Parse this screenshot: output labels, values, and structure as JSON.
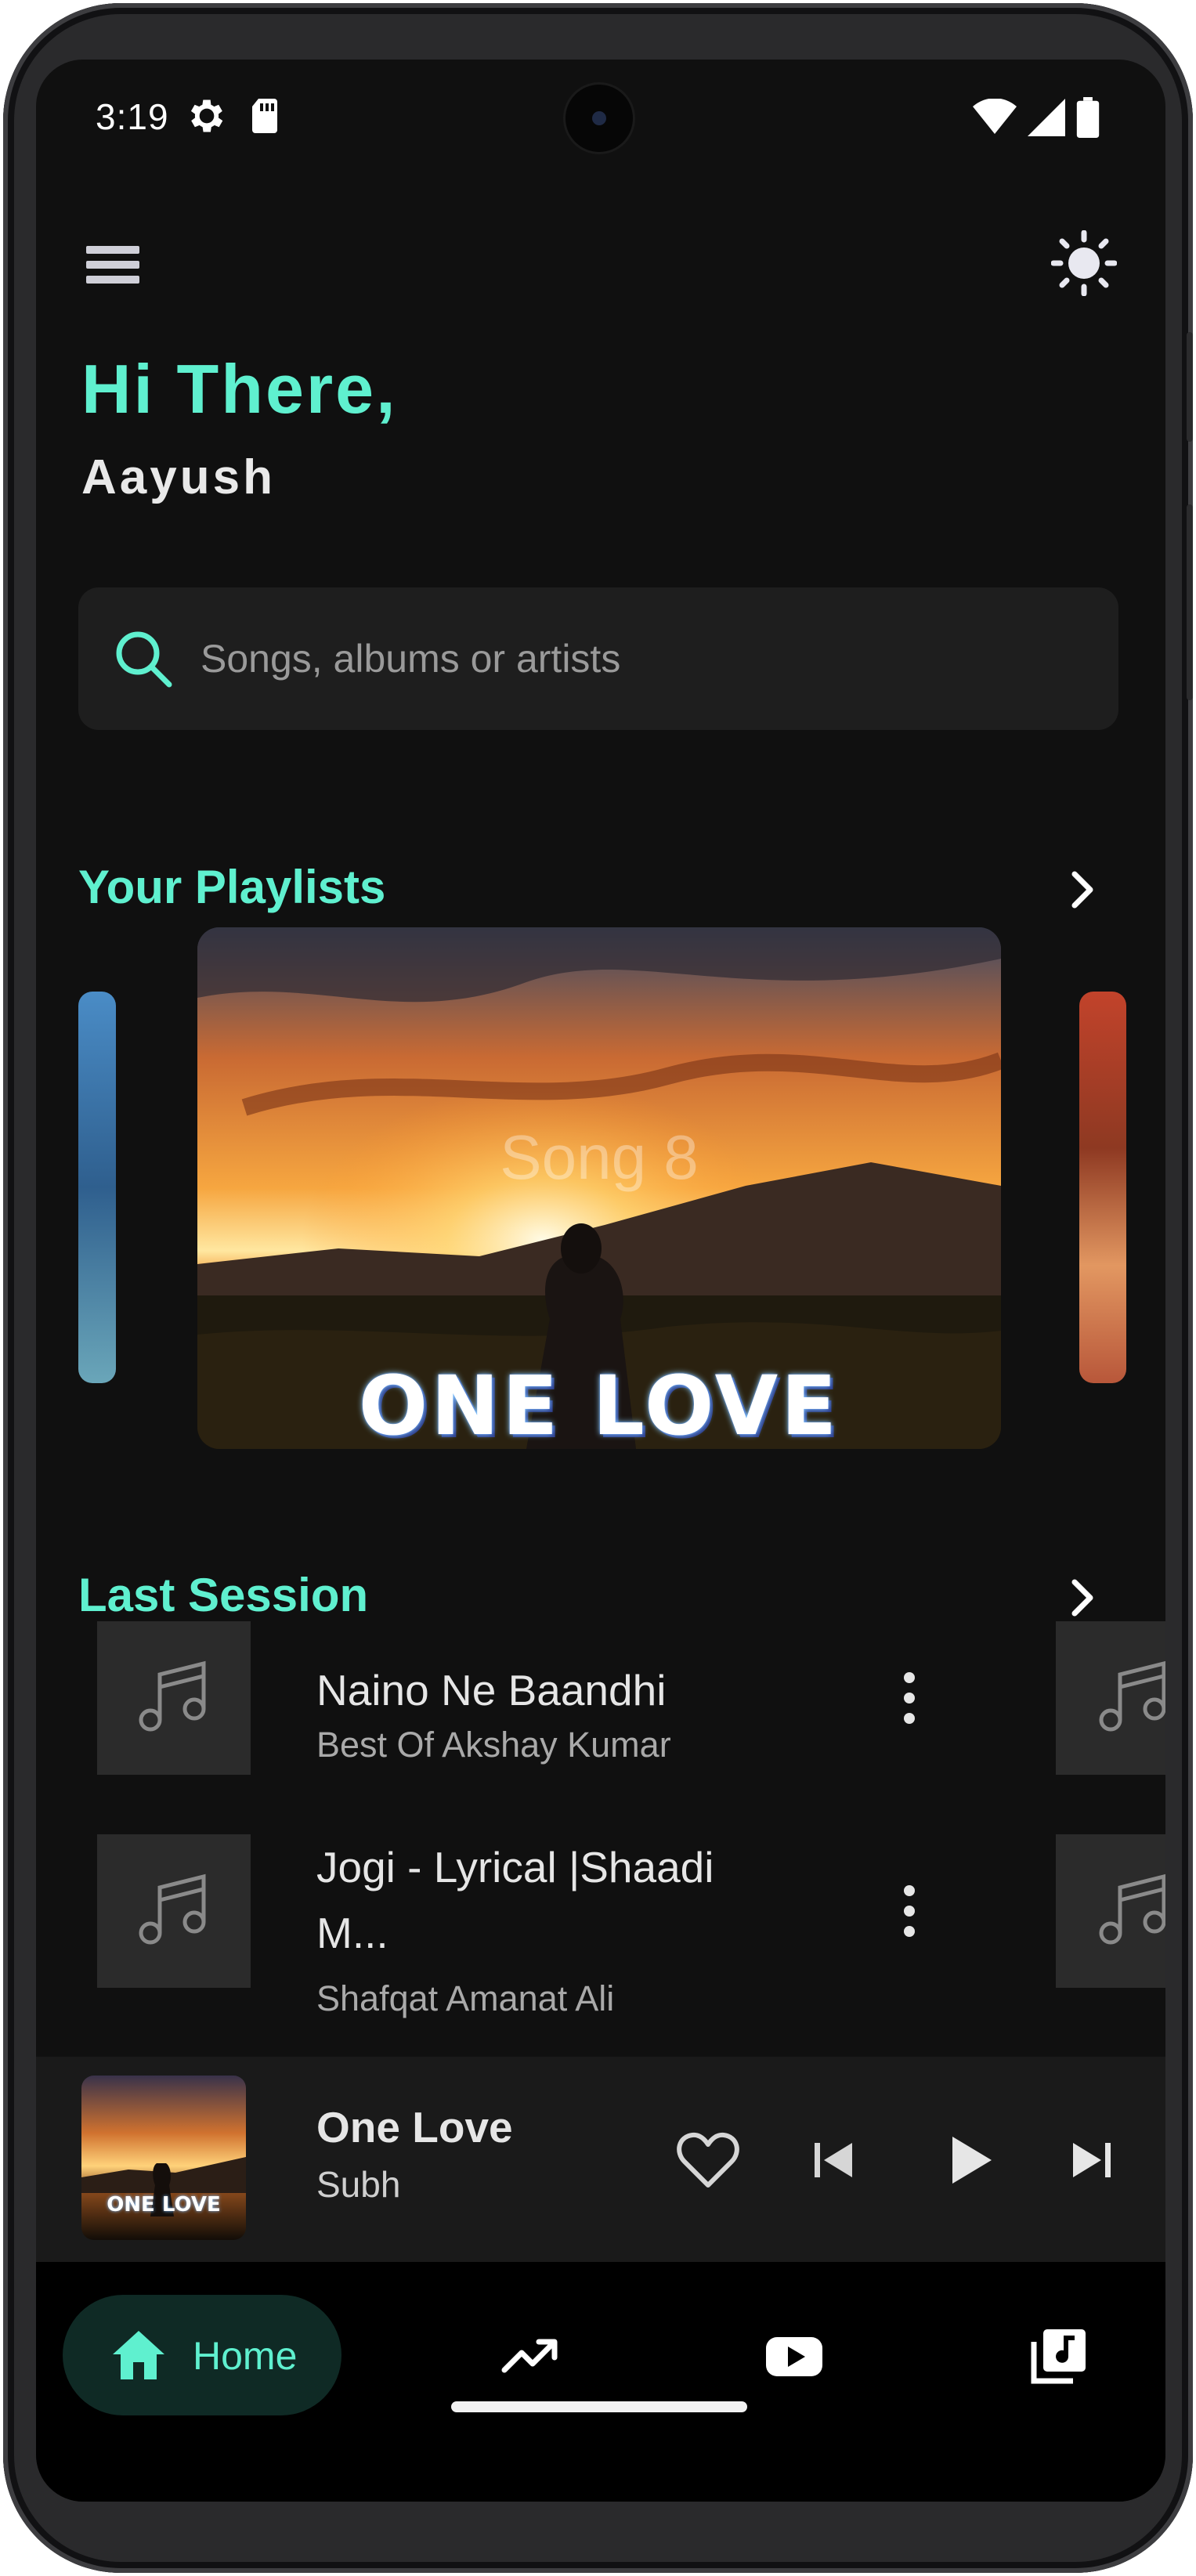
{
  "status_bar": {
    "time": "3:19",
    "icons": [
      "gear-icon",
      "sd-card-icon",
      "wifi-icon",
      "signal-icon",
      "battery-icon"
    ]
  },
  "header": {
    "menu_icon": "menu-icon",
    "theme_icon": "sun-icon",
    "greeting": "Hi There,",
    "user_name": "Aayush"
  },
  "search": {
    "placeholder": "Songs, albums or artists",
    "value": "",
    "icon": "search-icon"
  },
  "playlists": {
    "title": "Your Playlists",
    "featured": {
      "caption": "Song 8",
      "art_title": "ONE LOVE"
    }
  },
  "last_session": {
    "title": "Last Session",
    "songs": [
      {
        "title": "Naino Ne Baandhi",
        "artist": "Best Of Akshay Kumar"
      },
      {
        "title": "Jogi - Lyrical |Shaadi M...",
        "artist": "Shafqat Amanat Ali"
      }
    ]
  },
  "now_playing": {
    "title": "One Love",
    "artist": "Subh",
    "art_label": "ONE LOVE",
    "controls": [
      "heart-icon",
      "skip-previous-icon",
      "play-icon",
      "skip-next-icon"
    ]
  },
  "bottom_nav": {
    "items": [
      {
        "label": "Home",
        "icon": "home-icon",
        "active": true
      },
      {
        "label": "",
        "icon": "trending-icon",
        "active": false
      },
      {
        "label": "",
        "icon": "youtube-icon",
        "active": false
      },
      {
        "label": "",
        "icon": "library-music-icon",
        "active": false
      }
    ]
  },
  "colors": {
    "accent": "#5ff0cf",
    "background": "#101010",
    "surface": "#1e1e1e",
    "nav_background": "#000000"
  }
}
